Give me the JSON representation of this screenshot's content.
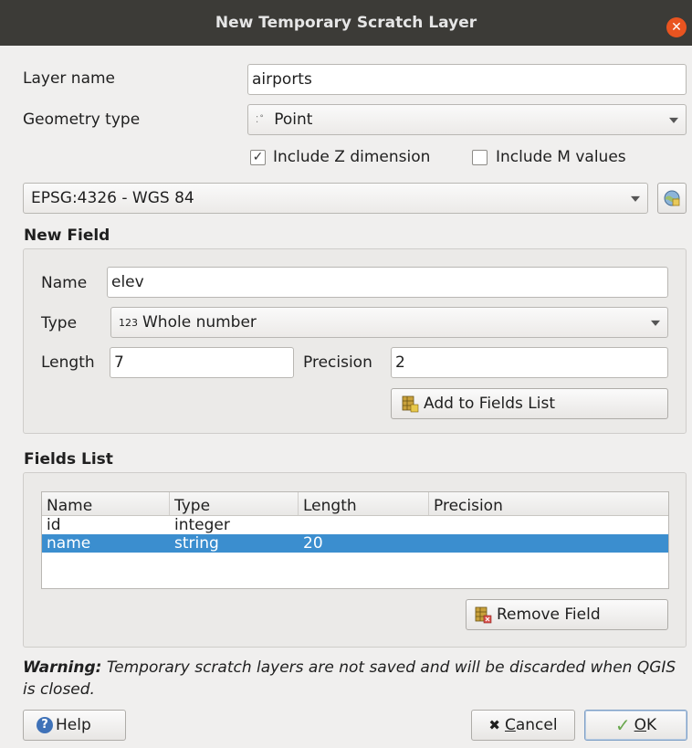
{
  "window": {
    "title": "New Temporary Scratch Layer"
  },
  "layer": {
    "name_label": "Layer name",
    "name_value": "airports",
    "geometry_label": "Geometry type",
    "geometry_value": "Point",
    "include_z_label": "Include Z dimension",
    "include_z_checked": true,
    "include_m_label": "Include M values",
    "include_m_checked": false,
    "crs_value": "EPSG:4326 - WGS 84"
  },
  "new_field": {
    "title": "New Field",
    "name_label": "Name",
    "name_value": "elev",
    "type_label": "Type",
    "type_prefix": "123",
    "type_value": "Whole number",
    "length_label": "Length",
    "length_value": "7",
    "precision_label": "Precision",
    "precision_value": "2",
    "add_button": "Add to Fields List"
  },
  "fields_list": {
    "title": "Fields List",
    "columns": [
      "Name",
      "Type",
      "Length",
      "Precision"
    ],
    "rows": [
      {
        "name": "id",
        "type": "integer",
        "length": "",
        "precision": "",
        "selected": false
      },
      {
        "name": "name",
        "type": "string",
        "length": "20",
        "precision": "",
        "selected": true
      }
    ],
    "remove_button": "Remove Field"
  },
  "warning": {
    "bold": "Warning:",
    "text": " Temporary scratch layers are not saved and will be discarded when QGIS is closed."
  },
  "buttons": {
    "help": "Help",
    "cancel_first": "C",
    "cancel_rest": "ancel",
    "ok_first": "O",
    "ok_rest": "K"
  },
  "colors": {
    "accent": "#e95420",
    "selection": "#3b8ecf",
    "titlebar": "#3c3b37"
  }
}
